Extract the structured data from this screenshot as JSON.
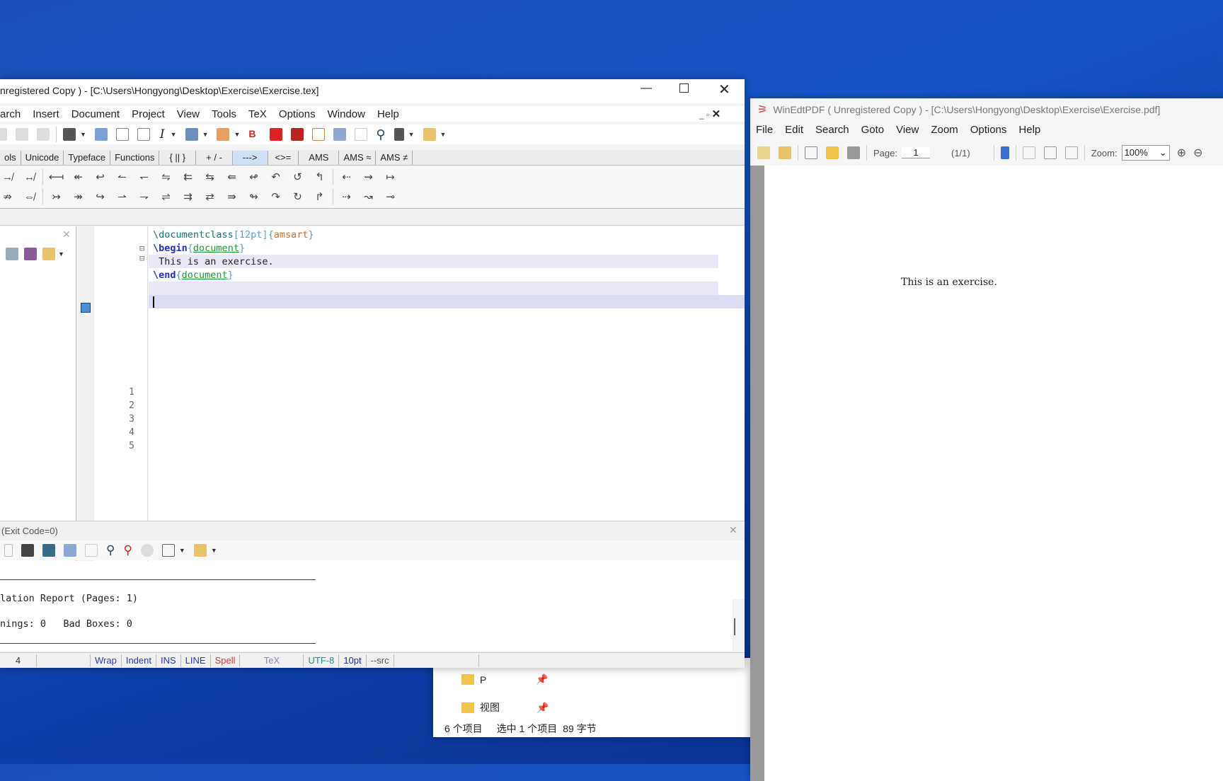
{
  "editor": {
    "title": "nregistered  Copy ) - [C:\\Users\\Hongyong\\Desktop\\Exercise\\Exercise.tex]",
    "menu": [
      "arch",
      "Insert",
      "Document",
      "Project",
      "View",
      "Tools",
      "TeX",
      "Options",
      "Window",
      "Help"
    ],
    "tabs": [
      "ols",
      "Unicode",
      "Typeface",
      "Functions",
      "{ || }",
      "+ / -",
      "--->",
      "<>=",
      "AMS",
      "AMS ≈",
      "AMS ≠"
    ],
    "symbols_row1": [
      "↛",
      "↮",
      "⟻",
      "↞",
      "↩",
      "↼",
      "↽",
      "⇋",
      "⇇",
      "⇆",
      "⇚",
      "↫",
      "↶",
      "↺",
      "↰",
      "⇠",
      "⇝",
      "↦"
    ],
    "symbols_row2": [
      "⇏",
      "⇎",
      "↣",
      "↠",
      "↪",
      "⇀",
      "⇁",
      "⇌",
      "⇉",
      "⇄",
      "⇛",
      "↬",
      "↷",
      "↻",
      "↱",
      "⇢",
      "↝",
      "⊸"
    ],
    "line_numbers": [
      "1",
      "2",
      "3",
      "4",
      "5"
    ],
    "code": {
      "l2": {
        "cmd": "\\documentclass",
        "opt": "[12pt]",
        "arg": "amsart"
      },
      "l3": {
        "cmd": "\\begin",
        "arg": "document"
      },
      "l4": " This is an exercise.",
      "l5": {
        "cmd": "\\end",
        "arg": "document"
      }
    },
    "log": {
      "header": "(Exit Code=0)",
      "report": "lation Report (Pages: 1)",
      "warnings": "nings: 0   Bad Boxes: 0"
    },
    "status": [
      "4",
      "",
      "Wrap",
      "Indent",
      "INS",
      "LINE",
      "Spell",
      "TeX",
      "UTF-8",
      "10pt",
      "--src",
      ""
    ]
  },
  "pdf": {
    "title": "WinEdtPDF  ( Unregistered  Copy ) - [C:\\Users\\Hongyong\\Desktop\\Exercise\\Exercise.pdf]",
    "menu": [
      "File",
      "Edit",
      "Search",
      "Goto",
      "View",
      "Zoom",
      "Options",
      "Help"
    ],
    "page_label": "Page:",
    "page_value": "1",
    "page_count": "(1/1)",
    "zoom_label": "Zoom:",
    "zoom_value": "100%",
    "content": "This is an exercise."
  },
  "explorer": {
    "items": [
      "P",
      "视图"
    ],
    "status": [
      "6 个项目",
      "选中 1 个项目",
      "89 字节"
    ]
  }
}
